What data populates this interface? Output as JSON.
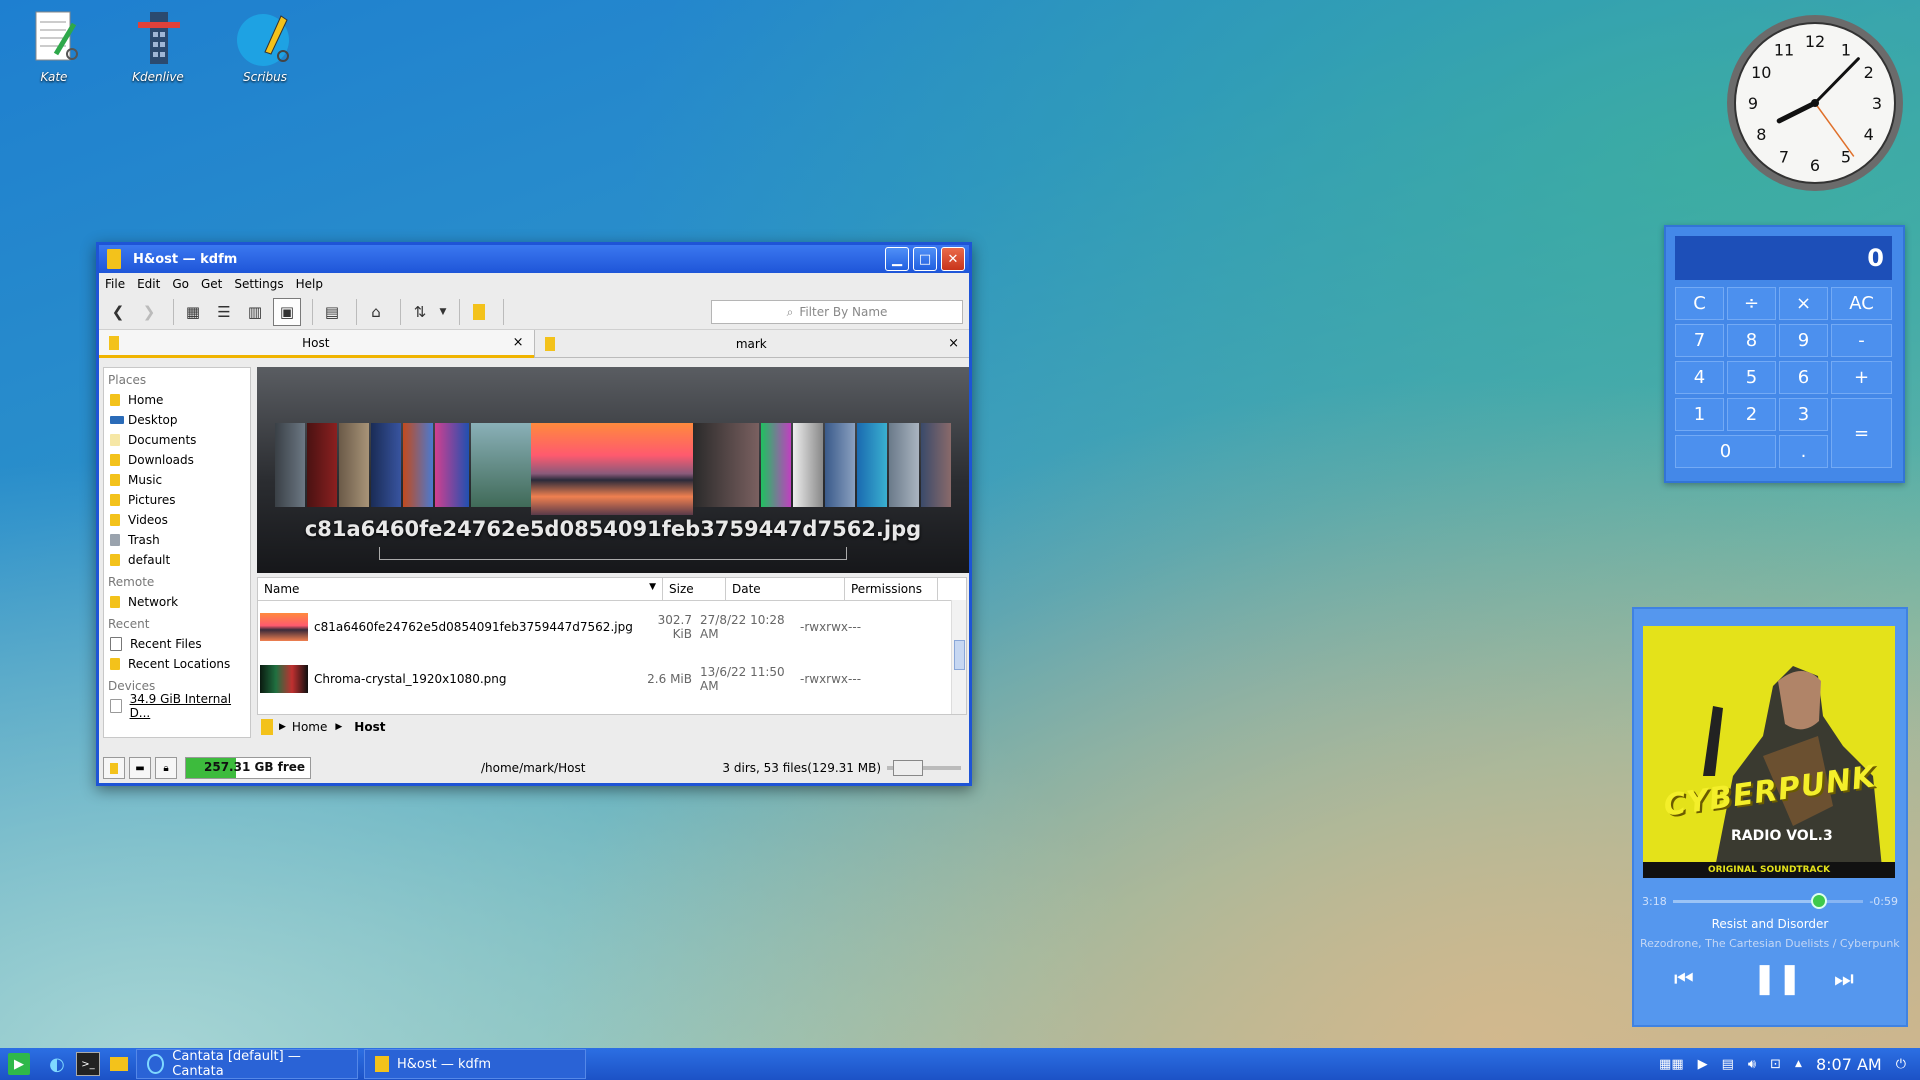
{
  "desktop": {
    "icons": [
      {
        "label": "Kate",
        "icon": "kate-notepad-icon"
      },
      {
        "label": "Kdenlive",
        "icon": "kdenlive-film-icon"
      },
      {
        "label": "Scribus",
        "icon": "scribus-pen-icon"
      }
    ],
    "clock": {
      "hour": 8,
      "minute": 7,
      "second": 24
    }
  },
  "window": {
    "title": "H&ost — kdfm",
    "menu": [
      "File",
      "Edit",
      "Go",
      "Get",
      "Settings",
      "Help"
    ],
    "filter_placeholder": "Filter By Name",
    "tabs": [
      {
        "label": "Host",
        "close": "×"
      },
      {
        "label": "mark",
        "close": "×"
      }
    ],
    "places": {
      "places_header": "Places",
      "places": [
        "Home",
        "Desktop",
        "Documents",
        "Downloads",
        "Music",
        "Pictures",
        "Videos",
        "Trash",
        "default"
      ],
      "remote_header": "Remote",
      "remote": [
        "Network"
      ],
      "recent_header": "Recent",
      "recent": [
        "Recent Files",
        "Recent Locations"
      ],
      "devices_header": "Devices",
      "devices": [
        "34.9 GiB Internal D..."
      ]
    },
    "coverflow_name": "c81a6460fe24762e5d0854091feb3759447d7562.jpg",
    "columns": {
      "name": "Name",
      "size": "Size",
      "date": "Date",
      "permissions": "Permissions"
    },
    "files": [
      {
        "name": "c81a6460fe24762e5d0854091feb3759447d7562.jpg",
        "size": "302.7 KiB",
        "date": "27/8/22 10:28 AM",
        "permissions": "-rwxrwx---"
      },
      {
        "name": "Chroma-crystal_1920x1080.png",
        "size": "2.6 MiB",
        "date": "13/6/22 11:50 AM",
        "permissions": "-rwxrwx---"
      }
    ],
    "breadcrumb": {
      "home": "Home",
      "current": "Host"
    },
    "status": {
      "free": "257.31 GB free",
      "path": "/home/mark/Host",
      "counts": "3 dirs, 53 files(129.31 MB)"
    }
  },
  "calculator": {
    "display": "0",
    "keys": [
      "C",
      "÷",
      "×",
      "AC",
      "7",
      "8",
      "9",
      "-",
      "4",
      "5",
      "6",
      "+",
      "1",
      "2",
      "3",
      "=",
      "0",
      "."
    ]
  },
  "player": {
    "elapsed": "3:18",
    "remaining": "-0:59",
    "progress": 0.77,
    "song": "Resist and Disorder",
    "artist": "Rezodrone, The Cartesian Duelists / Cyberpunk...",
    "cover_logo": "CYBERPUNK",
    "cover_title": "RADIO VOL.3",
    "cover_band": "ORIGINAL SOUNDTRACK"
  },
  "taskbar": {
    "tasks": [
      "Cantata [default] — Cantata",
      "H&ost — kdfm"
    ],
    "time": "8:07 AM"
  }
}
